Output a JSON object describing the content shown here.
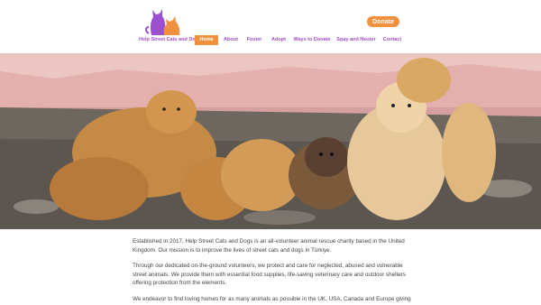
{
  "header": {
    "donate_label": "Donate",
    "brand_color": "#a050c0",
    "accent_color": "#f0913f"
  },
  "nav": {
    "items": [
      {
        "label": "Help Street Cats and Dogs",
        "active": false
      },
      {
        "label": "Home",
        "active": true
      },
      {
        "label": "About",
        "active": false
      },
      {
        "label": "Foster",
        "active": false
      },
      {
        "label": "Adopt",
        "active": false
      },
      {
        "label": "Ways to Donate",
        "active": false
      },
      {
        "label": "Spay and Neuter",
        "active": false
      },
      {
        "label": "Contact",
        "active": false
      }
    ]
  },
  "main": {
    "paragraphs": [
      "Established in 2017, Help Street Cats and Dogs is an all-volunteer animal rescue charity based in the United Kingdom. Our mission is to improve the lives of street cats and dogs in Türkiye.",
      "Through our dedicated on-the-ground volunteers, we protect and care for neglected, abused and vulnerable street animals. We provide them with essential food supplies, life-saving veterinary care and outdoor shelters offering protection from the elements.",
      "We endeavor to find loving homes for as many animals as possible in the UK, USA, Canada and Europe giving these deserving animals a second chance at life."
    ]
  },
  "hero": {
    "icon": "dogs-photo"
  }
}
